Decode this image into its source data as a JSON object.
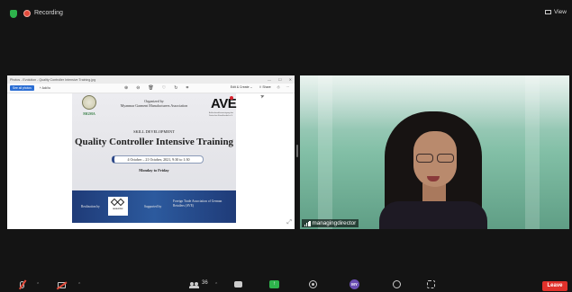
{
  "meeting": {
    "recording_label": "Recording",
    "view_label": "View"
  },
  "shared_screen": {
    "window_title": "Photos - Evolution - Quality Controller Intensive Training.jpg",
    "toolbar": {
      "all_photos": "See all photos",
      "add_to": "+ Add to",
      "edit_create": "Edit & Create ⌄",
      "share": "⇪ Share",
      "print": "⎙",
      "more": "···"
    },
    "slide": {
      "organized_by": "Organized by",
      "organizer": "Myanmar Garment Manufacturers Association",
      "left_logo_text": "MGMA",
      "right_logo_text": "AVE",
      "right_logo_sub": "Außenhandelsvereinigung des Deutschen Einzelhandels e.V.",
      "skill_development": "SKILL DEVELOPMENT",
      "title": "Quality Controller Intensive Training",
      "date_range": "4 October – 21 October, 2021, 9:30 to 1:30",
      "days": "Monday to Friday",
      "realization_label": "Realization by",
      "realization_logo": "BUILDTEX",
      "supported_label": "Supported by",
      "supporter": "Foreign Trade Association of German Retailers (AVE)"
    }
  },
  "video": {
    "participant_name": "managingdirector"
  },
  "controls": {
    "participants_count": "36",
    "avatar_initials": "MY",
    "leave_label": "Leave"
  },
  "colors": {
    "background": "#141414",
    "share_green": "#2eb34c",
    "leave_red": "#e0312b",
    "recording_red": "#e24b3b",
    "slide_band": "#1f3b78"
  }
}
